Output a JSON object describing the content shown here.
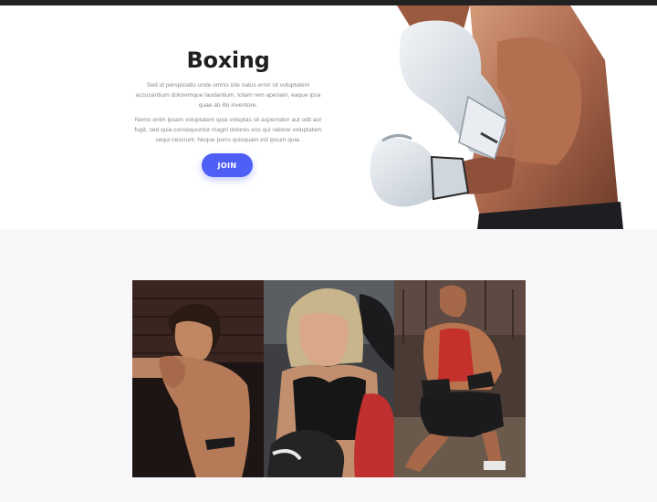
{
  "hero": {
    "title": "Boxing",
    "paragraph_1": "Sed ut perspiciatis unde omnis iste natus error sit voluptatem accusantium doloremque laudantium, totam rem aperiam, eaque ipsa quae ab illo inventore.",
    "paragraph_2": "Nemo enim ipsam voluptatem quia voluptas sit aspernatur aut odit aut fugit, sed quia consequuntur magni dolores eos qui ratione voluptatem sequi nesciunt. Neque porro quisquam est ipsum quia.",
    "join_label": "JOIN",
    "image_icon": "boxer-with-white-gloves-photo"
  },
  "gallery": {
    "items": [
      {
        "icon": "male-boxer-photo"
      },
      {
        "icon": "female-boxer-photo"
      },
      {
        "icon": "athlete-training-photo"
      }
    ]
  },
  "colors": {
    "accent": "#4e5ff5",
    "page_bg": "#f8f6f9",
    "topbar": "#222222"
  }
}
